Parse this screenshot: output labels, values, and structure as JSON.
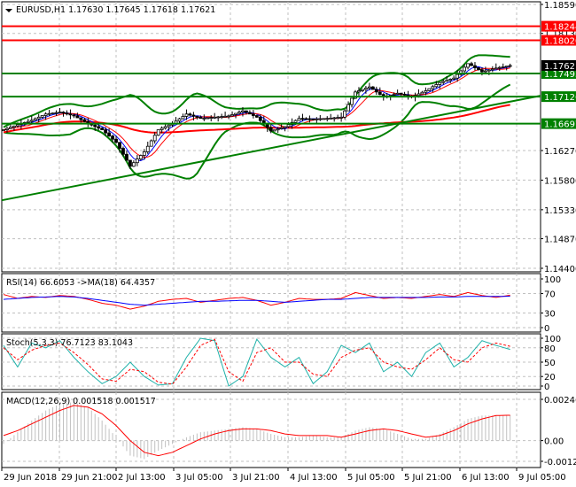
{
  "header": {
    "symbol": "EURUSD,H1",
    "ohlc": "1.17630 1.17645 1.17618 1.17621"
  },
  "chart_data": [
    {
      "type": "candlestick",
      "title": "EURUSD,H1 1.17630 1.17645 1.17618 1.17621",
      "ylim": [
        1.144,
        1.1859
      ],
      "y_ticks": [
        "1.18590",
        "1.18130",
        "1.16270",
        "1.15800",
        "1.15330",
        "1.14870",
        "1.14400"
      ],
      "y_tick_values": [
        1.1859,
        1.1813,
        1.1627,
        1.158,
        1.1533,
        1.1487,
        1.144
      ],
      "current_price": {
        "label": "1.17621",
        "value": 1.17621
      },
      "levels": [
        {
          "label": "1.18244",
          "value": 1.18244,
          "color": "#ff0000"
        },
        {
          "label": "1.18020",
          "value": 1.1802,
          "color": "#ff0000"
        },
        {
          "label": "1.17493",
          "value": 1.17493,
          "color": "#008000"
        },
        {
          "label": "1.17126",
          "value": 1.17126,
          "color": "#008000"
        },
        {
          "label": "1.16697",
          "value": 1.16697,
          "color": "#008000"
        }
      ],
      "bars_per_sample": 4,
      "closes": [
        1.166,
        1.1668,
        1.1675,
        1.1685,
        1.1688,
        1.1682,
        1.167,
        1.166,
        1.164,
        1.1602,
        1.1625,
        1.166,
        1.167,
        1.1685,
        1.1678,
        1.168,
        1.1682,
        1.169,
        1.168,
        1.1658,
        1.1665,
        1.1678,
        1.1677,
        1.1678,
        1.168,
        1.172,
        1.1728,
        1.1712,
        1.1718,
        1.1712,
        1.1722,
        1.1735,
        1.1742,
        1.1765,
        1.1752,
        1.1758,
        1.1762
      ],
      "trendline": [
        1.1548,
        1.1714
      ]
    },
    {
      "type": "line",
      "title": "RSI(14) 66.6053 ->MA(18) 64.4357",
      "ylim": [
        0,
        100
      ],
      "y_ticks": [
        "100",
        "70",
        "30",
        "0"
      ],
      "y_tick_values": [
        100,
        70,
        30,
        0
      ],
      "series": [
        {
          "name": "RSI(14)",
          "color": "#ff0000",
          "values": [
            68,
            60,
            64,
            62,
            66,
            64,
            58,
            50,
            46,
            38,
            44,
            54,
            58,
            60,
            52,
            56,
            60,
            62,
            56,
            46,
            52,
            60,
            58,
            58,
            60,
            72,
            66,
            60,
            62,
            60,
            64,
            68,
            64,
            72,
            66,
            62,
            66.6
          ]
        },
        {
          "name": "MA(18)",
          "color": "#0000ff",
          "values": [
            58,
            60,
            62,
            63,
            64,
            63,
            60,
            56,
            52,
            48,
            46,
            48,
            50,
            52,
            54,
            54,
            55,
            56,
            56,
            54,
            52,
            54,
            56,
            58,
            58,
            60,
            62,
            62,
            62,
            62,
            62,
            63,
            63,
            64,
            64,
            64,
            64.4
          ]
        }
      ]
    },
    {
      "type": "line",
      "title": "Stoch(5,3,3) 76.7123 83.1043",
      "ylim": [
        0,
        100
      ],
      "y_ticks": [
        "100",
        "80",
        "50",
        "20",
        "0"
      ],
      "y_tick_values": [
        100,
        80,
        50,
        20,
        0
      ],
      "series": [
        {
          "name": "main",
          "color": "#20b2aa",
          "values": [
            85,
            40,
            90,
            80,
            95,
            60,
            30,
            5,
            20,
            50,
            20,
            2,
            5,
            60,
            100,
            95,
            0,
            20,
            98,
            60,
            40,
            60,
            5,
            30,
            85,
            70,
            90,
            30,
            50,
            20,
            70,
            90,
            40,
            60,
            95,
            85,
            76.7
          ]
        },
        {
          "name": "signal",
          "color": "#ff0000",
          "values": [
            80,
            55,
            75,
            85,
            90,
            70,
            45,
            15,
            10,
            35,
            30,
            8,
            4,
            40,
            85,
            98,
            30,
            10,
            70,
            80,
            50,
            50,
            25,
            20,
            60,
            75,
            80,
            50,
            40,
            35,
            55,
            80,
            55,
            50,
            80,
            90,
            83.1
          ]
        }
      ]
    },
    {
      "type": "bar",
      "title": "MACD(12,26,9) 0.001518 0.001517",
      "ylim": [
        -0.001239,
        0.002468
      ],
      "y_ticks": [
        "0.002468",
        "0.00",
        "-0.001239"
      ],
      "y_tick_values": [
        0.002468,
        0,
        -0.001239
      ],
      "series": [
        {
          "name": "MACD",
          "color": "#c0c0c0",
          "values": [
            -0.0002,
            0.0005,
            0.0012,
            0.0018,
            0.0022,
            0.0023,
            0.002,
            0.0012,
            0.0002,
            -0.0009,
            -0.0011,
            -0.0006,
            -0.0002,
            0.0002,
            0.0005,
            0.0006,
            0.0007,
            0.0008,
            0.0007,
            0.0004,
            0.0002,
            0.0002,
            0.0003,
            0.0002,
            0.0002,
            0.0006,
            0.0008,
            0.0007,
            0.0004,
            0.0001,
            0.0001,
            0.0004,
            0.0008,
            0.0013,
            0.0015,
            0.0015,
            0.001518
          ]
        },
        {
          "name": "Signal",
          "color": "#ff0000",
          "values": [
            0.0003,
            0.0006,
            0.001,
            0.0014,
            0.0018,
            0.0021,
            0.002,
            0.0016,
            0.0009,
            0.0,
            -0.0007,
            -0.0009,
            -0.0007,
            -0.0003,
            0.0001,
            0.0004,
            0.0006,
            0.0007,
            0.0007,
            0.0006,
            0.0004,
            0.0003,
            0.0003,
            0.0003,
            0.0002,
            0.0004,
            0.0006,
            0.0007,
            0.0006,
            0.0004,
            0.0002,
            0.0003,
            0.0006,
            0.001,
            0.0013,
            0.0015,
            0.001517
          ]
        }
      ]
    }
  ],
  "x_ticks": [
    "29 Jun 2018",
    "29 Jun 21:00",
    "2 Jul 13:00",
    "3 Jul 05:00",
    "3 Jul 21:00",
    "4 Jul 13:00",
    "5 Jul 05:00",
    "5 Jul 21:00",
    "6 Jul 13:00",
    "9 Jul 05:00"
  ]
}
